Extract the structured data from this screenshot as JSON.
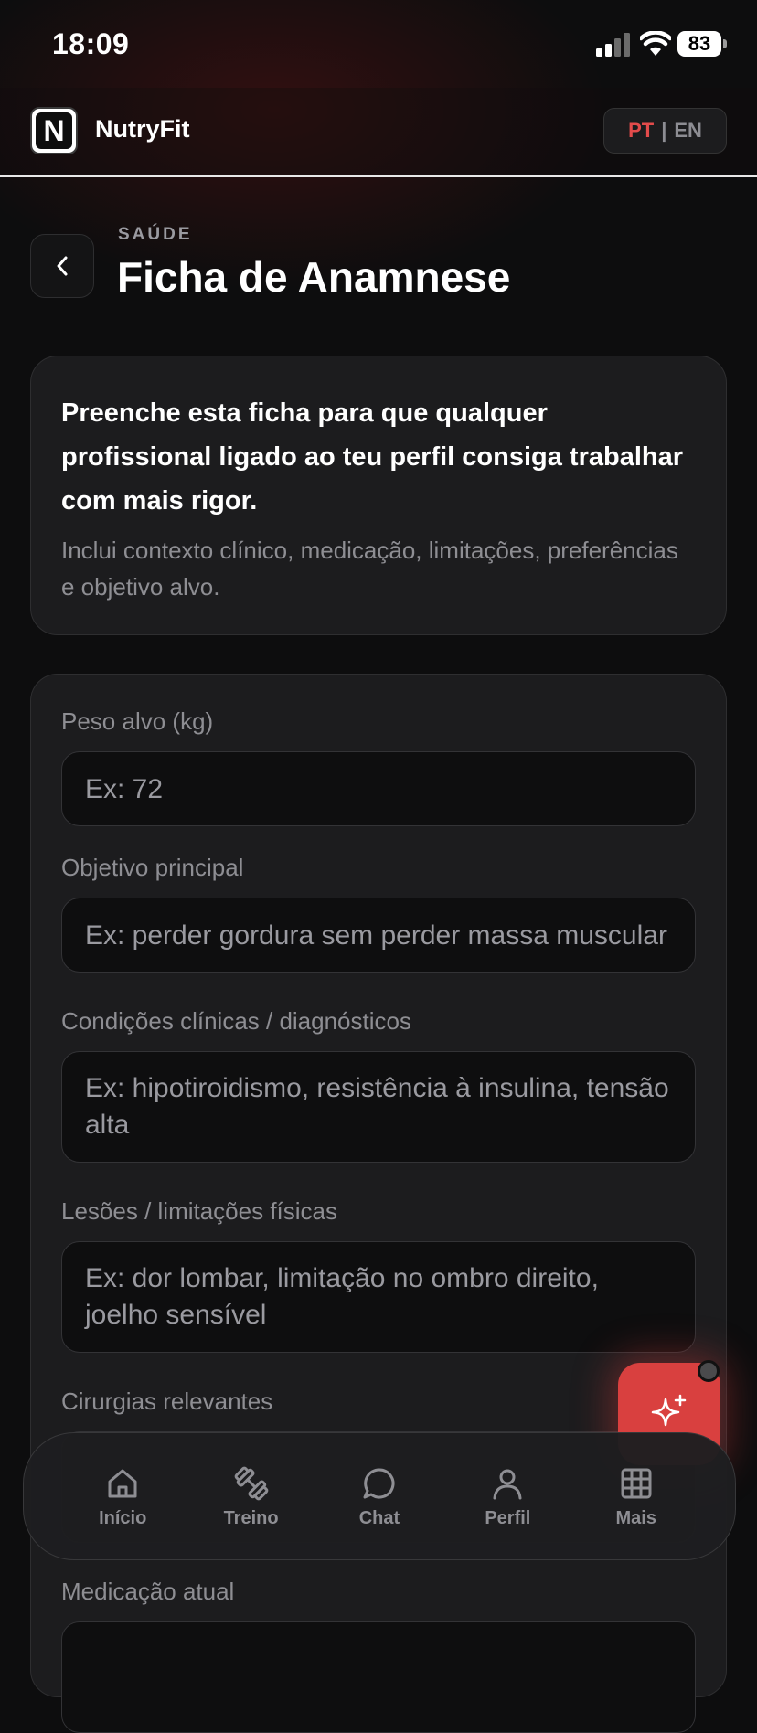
{
  "status_bar": {
    "time": "18:09",
    "battery": "83"
  },
  "header": {
    "app_name": "NutryFit",
    "logo_letter": "N",
    "lang_pt": "PT",
    "lang_separator": "|",
    "lang_en": "EN"
  },
  "page": {
    "eyebrow": "SAÚDE",
    "title": "Ficha de Anamnese"
  },
  "intro": {
    "main": "Preenche esta ficha para que qualquer profissional ligado ao teu perfil consiga trabalhar com mais rigor.",
    "sub": "Inclui contexto clínico, medicação, limitações, preferências e objetivo alvo."
  },
  "form": {
    "fields": [
      {
        "label": "Peso alvo (kg)",
        "placeholder": "Ex: 72"
      },
      {
        "label": "Objetivo principal",
        "placeholder": "Ex: perder gordura sem perder massa muscular"
      },
      {
        "label": "Condições clínicas / diagnósticos",
        "placeholder": "Ex: hipotiroidismo, resistência à insulina, tensão alta"
      },
      {
        "label": "Lesões / limitações físicas",
        "placeholder": "Ex: dor lombar, limitação no ombro direito, joelho sensível"
      },
      {
        "label": "Cirurgias relevantes",
        "placeholder": ""
      },
      {
        "label": "Medicação atual",
        "placeholder": ""
      }
    ]
  },
  "nav": {
    "items": [
      {
        "label": "Início",
        "icon": "home-icon"
      },
      {
        "label": "Treino",
        "icon": "dumbbell-icon"
      },
      {
        "label": "Chat",
        "icon": "chat-bubble-icon"
      },
      {
        "label": "Perfil",
        "icon": "user-icon"
      },
      {
        "label": "Mais",
        "icon": "grid-icon"
      }
    ]
  },
  "colors": {
    "accent": "#e34b4b",
    "fab": "#d9403f",
    "background": "#0d0d0e",
    "card": "#1c1c1e"
  }
}
